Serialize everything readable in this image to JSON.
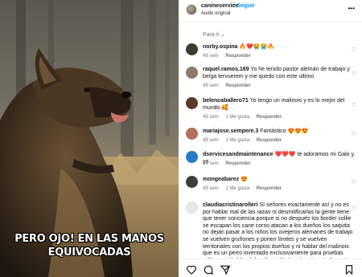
{
  "video": {
    "caption_line1": "PERO OJO! EN LAS MANOS",
    "caption_line2": "EQUIVOCADAS"
  },
  "header": {
    "username": "canineservice",
    "separator": "•",
    "follow_label": "Seguir",
    "audio_label": "Audio original",
    "more_icon": "more-horizontal-icon"
  },
  "sort_label": "Para ti",
  "comments": [
    {
      "username": "norby.ospina",
      "text": "🔥❤️😭😭🔥",
      "time": "49 sem",
      "likes": "",
      "reply": "Responder",
      "avatar_color": "#3c3c2e"
    },
    {
      "username": "raquel.ramos.169",
      "text": "Yo he tenido pastor alemán de trabajo y belga tervuerem y me quedo con este ultimo",
      "time": "49 sem",
      "likes": "",
      "reply": "Responder",
      "avatar_color": "#8a7a6a"
    },
    {
      "username": "belencaballero71",
      "text": "Yo tengo un malinois y es lo mejor del mundo 🥰",
      "time": "49 sem",
      "likes": "1 Me gusta",
      "reply": "Responder",
      "avatar_color": "#5b3a2a"
    },
    {
      "username": "mariajose.sempere.3",
      "text": "Fantástico 😍😍😍",
      "time": "49 sem",
      "likes": "1 Me gusta",
      "reply": "Responder",
      "avatar_color": "#b0705a"
    },
    {
      "username": "dservicesandmaintenance",
      "text": "❤️❤️❤️ te adoramos mi Galo y yo",
      "time": "49 sem",
      "likes": "",
      "reply": "Responder",
      "avatar_color": "#2b7bc4"
    },
    {
      "username": "mongeabarez",
      "text": "😍",
      "time": "49 sem",
      "likes": "1 Me gusta",
      "reply": "Responder",
      "avatar_color": "#3d3d3d"
    },
    {
      "username": "claudiacristinarolleri",
      "text": "Sí señores exactamente así y no es por hablar mal de las razas ni desmitificarlas la gente tiene que tener conciencia porque si no después los border collie se escapan los cane corso atacan a los dueños los saquita no dejan pasar a los niños los ovejeros alemanes de trabajo se vuelven gruñones y ponen límites y se vuelven territoriales con los propios dueños y ni hablar del malinois que es un perro inventado exclusivamente para pruebas militares ni hablar del malinois Y cómo terminan todos estos animales en la calle Así",
      "time": "",
      "likes": "",
      "reply": "",
      "avatar_color": "#e8e8e8"
    }
  ],
  "actions": {
    "like_icon": "heart-icon",
    "comment_icon": "comment-icon",
    "share_icon": "send-icon",
    "save_icon": "bookmark-icon"
  },
  "colors": {
    "link_blue": "#0095f6",
    "meta_gray": "#737373"
  }
}
